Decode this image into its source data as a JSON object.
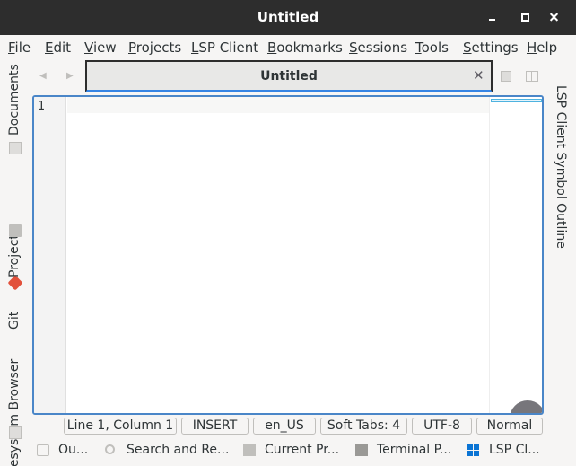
{
  "window": {
    "title": "Untitled"
  },
  "menubar": {
    "items": [
      {
        "label": "File",
        "underline": "F",
        "rest": "ile"
      },
      {
        "label": "Edit",
        "underline": "E",
        "rest": "dit"
      },
      {
        "label": "View",
        "underline": "V",
        "rest": "iew"
      },
      {
        "label": "Projects",
        "underline": "P",
        "rest": "rojects"
      },
      {
        "label": "LSP Client",
        "underline": "L",
        "rest": "SP Client"
      },
      {
        "label": "Bookmarks",
        "underline": "B",
        "rest": "ookmarks"
      },
      {
        "label": "Sessions",
        "underline": "S",
        "rest": "essions"
      },
      {
        "label": "Tools",
        "underline": "T",
        "rest": "ools"
      },
      {
        "label": "Settings",
        "underline": "S",
        "rest": "ettings"
      },
      {
        "label": "Help",
        "underline": "H",
        "rest": "elp"
      }
    ]
  },
  "left_sidebar": {
    "tabs": [
      {
        "label": "Documents",
        "icon": "document-icon"
      },
      {
        "label": "Projects",
        "icon": "folder-icon"
      },
      {
        "label": "Git",
        "icon": "git-icon"
      },
      {
        "label": "Filesystem Browser",
        "icon": "document-icon"
      }
    ]
  },
  "right_sidebar": {
    "label": "LSP Client Symbol Outline"
  },
  "tab": {
    "title": "Untitled",
    "close": "✕"
  },
  "editor": {
    "line_number": "1",
    "accent": "#4a86c8"
  },
  "statusbar": {
    "cursor": "Line 1, Column 1",
    "mode": "INSERT",
    "language": "en_US",
    "indent": "Soft Tabs: 4",
    "encoding": "UTF-8",
    "input_mode": "Normal"
  },
  "bottom_tools": [
    {
      "label": "Ou...",
      "icon": "chat-icon"
    },
    {
      "label": "Search and Re...",
      "icon": "search-icon"
    },
    {
      "label": "Current Pr...",
      "icon": "project-icon"
    },
    {
      "label": "Terminal P...",
      "icon": "terminal-icon"
    },
    {
      "label": "LSP Cl...",
      "icon": "lsp-client-icon"
    }
  ]
}
